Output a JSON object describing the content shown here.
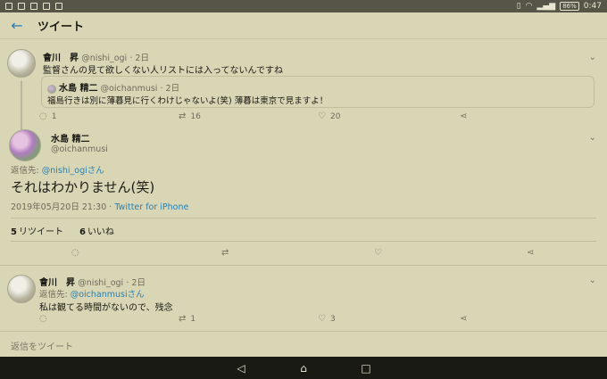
{
  "status_bar": {
    "battery": "86%",
    "time": "0:47"
  },
  "appbar": {
    "back_icon": "arrow-left-icon",
    "title": "ツイート"
  },
  "tweet_1": {
    "name": "會川　昇",
    "handle": "@nishi_ogi",
    "time": "· 2日",
    "text": "監督さんの見て欲しくない人リストには入ってないんですね",
    "quote": {
      "name": "水島 精二",
      "handle": "@oichanmusi",
      "time": "· 2日",
      "text": "福島行きは別に薄暮見に行くわけじゃないよ(笑) 薄暮は東京で見ますよ！"
    },
    "replies": "1",
    "retweets": "16",
    "likes": "20"
  },
  "main_tweet": {
    "name": "水島 精二",
    "handle": "@oichanmusi",
    "replying_prefix": "返信先: ",
    "replying_to": "@nishi_ogiさん",
    "text": "それはわかりません(笑)",
    "datetime": "2019年05月20日 21:30",
    "separator": " · ",
    "source": "Twitter for iPhone",
    "retweet_count": "5",
    "retweet_label": "リツイート",
    "like_count": "6",
    "like_label": "いいね"
  },
  "tweet_3": {
    "name": "會川　昇",
    "handle": "@nishi_ogi",
    "time": "· 2日",
    "replying_prefix": "返信先: ",
    "replying_to": "@oichanmusiさん",
    "text": "私は観てる時間がないので、残念",
    "replies": "",
    "retweets": "1",
    "likes": "3"
  },
  "reply_box": {
    "placeholder": "返信をツイート"
  },
  "colors": {
    "accent": "#2a7fb0",
    "background": "#d9d6b5",
    "nav": "#1a1a14"
  }
}
